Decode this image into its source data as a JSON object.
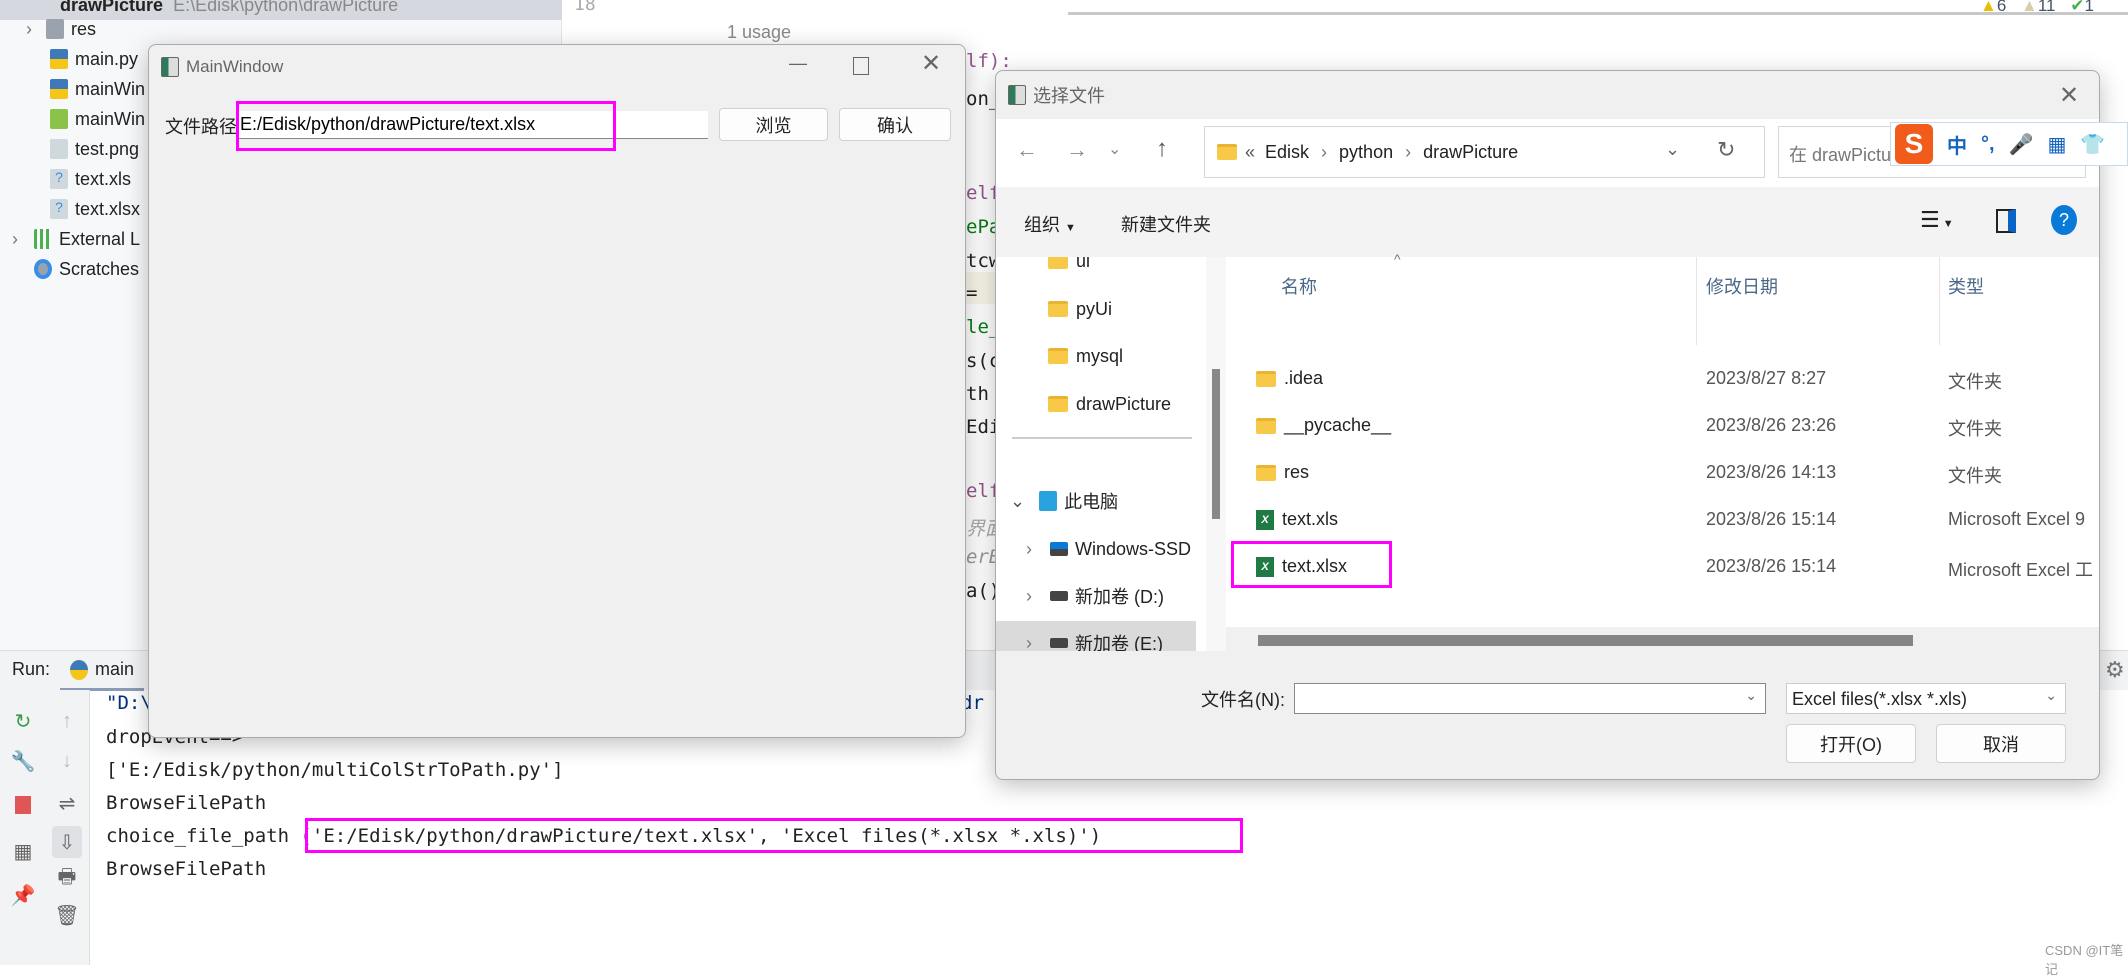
{
  "ide": {
    "project_root": "drawPicture",
    "project_root_path": "E:\\Edisk\\python\\drawPicture",
    "tree": [
      {
        "label": "res",
        "icon": "folder-icon"
      },
      {
        "label": "main.py",
        "icon": "python-file-icon"
      },
      {
        "label": "mainWin",
        "icon": "python-file-icon"
      },
      {
        "label": "mainWin",
        "icon": "qt-ui-file-icon"
      },
      {
        "label": "test.png",
        "icon": "image-file-icon"
      },
      {
        "label": "text.xls",
        "icon": "unknown-file-icon"
      },
      {
        "label": "text.xlsx",
        "icon": "unknown-file-icon"
      },
      {
        "label": "External L",
        "icon": "library-icon"
      },
      {
        "label": "Scratches",
        "icon": "scratches-icon"
      }
    ],
    "line_number": "18",
    "usage_hint": "1 usage",
    "inspections": {
      "warnings": "6",
      "weak_warnings": "11",
      "typos": "1"
    },
    "code_fragments": [
      "lf):",
      "on_",
      "elf",
      "ePa",
      "tcw",
      " =",
      "le_",
      "s(c",
      "th ",
      "Edi",
      "elf",
      "界面i",
      "erB",
      "a()"
    ],
    "run": {
      "label": "Run:",
      "tab": "main",
      "console": [
        "\"D:\\",
        "dropEvent==>",
        "['E:/Edisk/python/multiColStrToPath.py']",
        "BrowseFilePath",
        "choice_file_path ('E:/Edisk/python/drawPicture/text.xlsx', 'Excel files(*.xlsx *.xls)')",
        "BrowseFilePath"
      ],
      "console_tail": "dr"
    }
  },
  "main_window": {
    "title": "MainWindow",
    "path_label": "文件路径",
    "path_value": "E:/Edisk/python/drawPicture/text.xlsx",
    "browse": "浏览",
    "confirm": "确认"
  },
  "dialog": {
    "title": "选择文件",
    "breadcrumb": [
      "«",
      "Edisk",
      "python",
      "drawPicture"
    ],
    "search_placeholder": "在 drawPicture",
    "organize": "组织",
    "new_folder": "新建文件夹",
    "nav": [
      "ui",
      "pyUi",
      "mysql",
      "drawPicture"
    ],
    "this_pc": "此电脑",
    "drives": [
      "Windows-SSD",
      "新加卷 (D:)",
      "新加卷 (E:)"
    ],
    "columns": [
      "名称",
      "修改日期",
      "类型"
    ],
    "files": [
      {
        "name": ".idea",
        "date": "2023/8/27 8:27",
        "type": "文件夹",
        "icon": "folder-icon"
      },
      {
        "name": "__pycache__",
        "date": "2023/8/26 23:26",
        "type": "文件夹",
        "icon": "folder-icon"
      },
      {
        "name": "res",
        "date": "2023/8/26 14:13",
        "type": "文件夹",
        "icon": "folder-icon"
      },
      {
        "name": "text.xls",
        "date": "2023/8/26 15:14",
        "type": "Microsoft Excel 9",
        "icon": "excel-icon"
      },
      {
        "name": "text.xlsx",
        "date": "2023/8/26 15:14",
        "type": "Microsoft Excel 工",
        "icon": "excel-icon"
      }
    ],
    "filename_label": "文件名(N):",
    "filename_value": "",
    "filter": "Excel files(*.xlsx *.xls)",
    "open": "打开(O)",
    "cancel": "取消"
  },
  "ime": {
    "mode": "中",
    "punct": "°,"
  },
  "watermark": "CSDN @IT笔记",
  "colors": {
    "highlight": "#ff00ff",
    "accent": "#0067c0"
  }
}
